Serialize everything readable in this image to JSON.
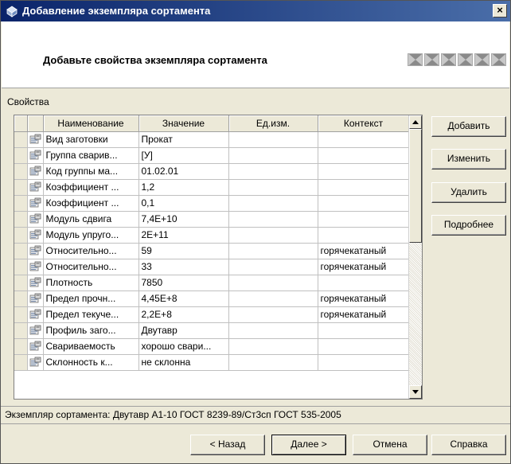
{
  "window": {
    "title": "Добавление экземпляра сортамента",
    "close_label": "×"
  },
  "header": {
    "heading": "Добавьте свойства экземпляра сортамента",
    "steps_count": 6
  },
  "properties": {
    "group_label": "Свойства",
    "columns": [
      "Наименование",
      "Значение",
      "Ед.изм.",
      "Контекст"
    ],
    "rows": [
      {
        "name": "Вид заготовки",
        "value": "Прокат",
        "unit": "",
        "context": ""
      },
      {
        "name": "Группа сварив...",
        "value": "[У]",
        "unit": "",
        "context": ""
      },
      {
        "name": "Код группы ма...",
        "value": "01.02.01",
        "unit": "",
        "context": ""
      },
      {
        "name": "Коэффициент ...",
        "value": "1,2",
        "unit": "",
        "context": ""
      },
      {
        "name": "Коэффициент ...",
        "value": "0,1",
        "unit": "",
        "context": ""
      },
      {
        "name": "Модуль сдвига",
        "value": "7,4E+10",
        "unit": "",
        "context": ""
      },
      {
        "name": "Модуль упруго...",
        "value": "2E+11",
        "unit": "",
        "context": ""
      },
      {
        "name": "Относительно...",
        "value": "59",
        "unit": "",
        "context": "горячекатаный"
      },
      {
        "name": "Относительно...",
        "value": "33",
        "unit": "",
        "context": "горячекатаный"
      },
      {
        "name": "Плотность",
        "value": "7850",
        "unit": "",
        "context": ""
      },
      {
        "name": "Предел прочн...",
        "value": "4,45E+8",
        "unit": "",
        "context": "горячекатаный"
      },
      {
        "name": "Предел текуче...",
        "value": "2,2E+8",
        "unit": "",
        "context": "горячекатаный"
      },
      {
        "name": "Профиль заго...",
        "value": "Двутавр",
        "unit": "",
        "context": ""
      },
      {
        "name": "Свариваемость",
        "value": "хорошо свари...",
        "unit": "",
        "context": ""
      },
      {
        "name": "Склонность к...",
        "value": "не склонна",
        "unit": "",
        "context": ""
      }
    ]
  },
  "side_buttons": {
    "add": "Добавить",
    "edit": "Изменить",
    "delete": "Удалить",
    "details": "Подробнее"
  },
  "status": {
    "text": "Экземпляр сортамента: Двутавр А1-10 ГОСТ 8239-89/Ст3сп ГОСТ 535-2005"
  },
  "footer": {
    "back": "< Назад",
    "next": "Далее >",
    "cancel": "Отмена",
    "help": "Справка"
  },
  "colors": {
    "titlebar_start": "#0a246a",
    "titlebar_end": "#4a6ea9",
    "dialog_bg": "#ece9d8"
  }
}
